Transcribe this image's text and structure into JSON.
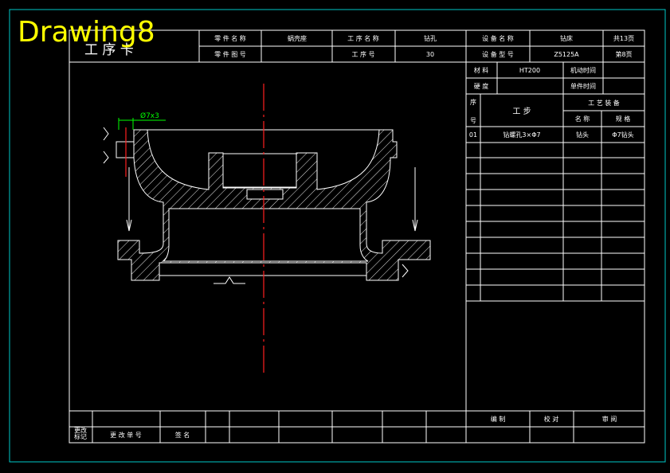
{
  "app": {
    "drawing_name": "Drawing8"
  },
  "header": {
    "title": "工 序 卡",
    "part_name_label": "零 件 名 称",
    "part_name_value": "蜗壳座",
    "process_name_label": "工 序 名 称",
    "process_name_value": "钻孔",
    "equipment_name_label": "设 备 名 称",
    "equipment_name_value": "钻床",
    "total_pages": "共13页",
    "part_drawing_no_label": "零 件 图 号",
    "part_drawing_no_value": "",
    "process_no_label": "工 序 号",
    "process_no_value": "30",
    "equipment_model_label": "设 备 型 号",
    "equipment_model_value": "Z5125A",
    "page_no": "第8页"
  },
  "material": {
    "material_label": "材 料",
    "material_value": "HT200",
    "machine_time_label": "机动时间",
    "hardness_label": "硬 度",
    "unit_time_label": "单件时间"
  },
  "steps_table": {
    "seq_label_top": "序",
    "seq_label_bottom": "号",
    "step_label": "工 步",
    "tooling_label": "工 艺 装 备",
    "name_label": "名 称",
    "spec_label": "规 格",
    "rows": [
      {
        "seq": "01",
        "step": "钻螺孔3×Φ7",
        "name": "钻头",
        "spec": "Φ7钻头"
      }
    ]
  },
  "drawing": {
    "annotation": "Ø7x3"
  },
  "footer": {
    "change_mark_line1": "更改",
    "change_mark_line2": "标记",
    "change_doc_no": "更 改 单 号",
    "signature": "签 名",
    "compile": "编 制",
    "check": "校 对",
    "review": "审 阅"
  }
}
